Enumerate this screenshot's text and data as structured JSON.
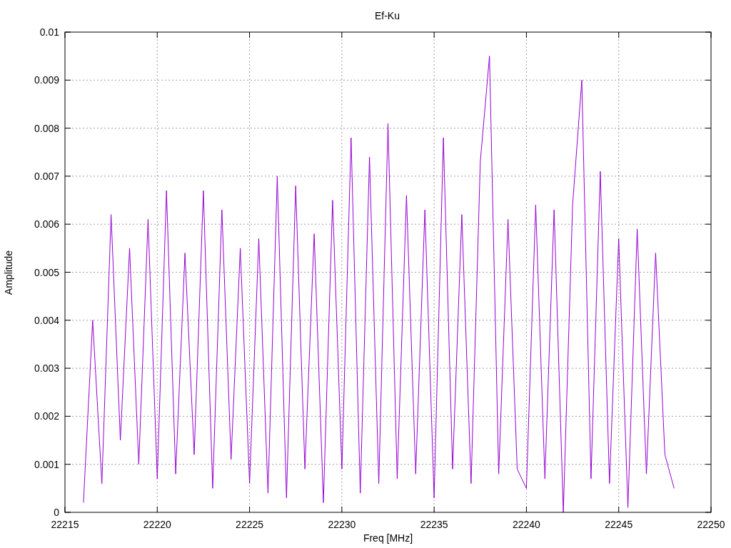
{
  "chart_data": {
    "type": "line",
    "title": "Ef-Ku",
    "xlabel": "Freq [MHz]",
    "ylabel": "Amplitude",
    "xlim": [
      22215,
      22250
    ],
    "ylim": [
      0,
      0.01
    ],
    "grid": true,
    "xticks": [
      22215,
      22220,
      22225,
      22230,
      22235,
      22240,
      22245,
      22250
    ],
    "yticks": [
      {
        "value": 0,
        "label": "0"
      },
      {
        "value": 0.001,
        "label": "0.001"
      },
      {
        "value": 0.002,
        "label": "0.002"
      },
      {
        "value": 0.003,
        "label": "0.003"
      },
      {
        "value": 0.004,
        "label": "0.004"
      },
      {
        "value": 0.005,
        "label": "0.005"
      },
      {
        "value": 0.006,
        "label": "0.006"
      },
      {
        "value": 0.007,
        "label": "0.007"
      },
      {
        "value": 0.008,
        "label": "0.008"
      },
      {
        "value": 0.009,
        "label": "0.009"
      },
      {
        "value": 0.01,
        "label": "0.01"
      }
    ],
    "x": [
      22216,
      22216.5,
      22217,
      22217.5,
      22218,
      22218.5,
      22219,
      22219.5,
      22220,
      22220.5,
      22221,
      22221.5,
      22222,
      22222.5,
      22223,
      22223.5,
      22224,
      22224.5,
      22225,
      22225.5,
      22226,
      22226.5,
      22227,
      22227.5,
      22228,
      22228.5,
      22229,
      22229.5,
      22230,
      22230.5,
      22231,
      22231.5,
      22232,
      22232.5,
      22233,
      22233.5,
      22234,
      22234.5,
      22235,
      22235.5,
      22236,
      22236.5,
      22237,
      22237.5,
      22238,
      22238.5,
      22239,
      22239.5,
      22240,
      22240.5,
      22241,
      22241.5,
      22242,
      22242.5,
      22243,
      22243.5,
      22244,
      22244.5,
      22245,
      22245.5,
      22246,
      22246.5,
      22247,
      22247.5,
      22248
    ],
    "series": [
      {
        "color": "#9400d3",
        "values": [
          0.0002,
          0.004,
          0.0006,
          0.0062,
          0.0015,
          0.0055,
          0.001,
          0.0061,
          0.0007,
          0.0067,
          0.0008,
          0.0054,
          0.0012,
          0.0067,
          0.0005,
          0.0063,
          0.0011,
          0.0055,
          0.0006,
          0.0057,
          0.0004,
          0.007,
          0.0003,
          0.0068,
          0.0009,
          0.0058,
          0.0002,
          0.0065,
          0.0009,
          0.0078,
          0.0004,
          0.0074,
          0.0006,
          0.0081,
          0.0007,
          0.0066,
          0.0008,
          0.0063,
          0.0003,
          0.0078,
          0.0009,
          0.0062,
          0.0006,
          0.0073,
          0.0095,
          0.0008,
          0.0061,
          0.0009,
          0.0005,
          0.0064,
          0.0007,
          0.0063,
          0.0,
          0.0064,
          0.009,
          0.0007,
          0.0071,
          0.0006,
          0.0057,
          0.0001,
          0.0059,
          0.0008,
          0.0054,
          0.0012,
          0.0005
        ]
      }
    ]
  }
}
